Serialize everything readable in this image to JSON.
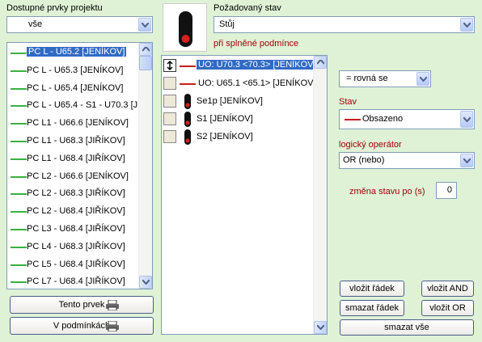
{
  "left": {
    "title": "Dostupné prvky projektu",
    "filter_value": "vše",
    "items": [
      "PC L - U65.2 [JENÍKOV]",
      "PC L - U65.3 [JENÍKOV]",
      "PC L - U65.4 [JENÍKOV]",
      "PC L - U65.4 - S1 - U70.3 [JEI",
      "PC L1 - U66.6 [JENÍKOV]",
      "PC L1 - U68.3 [JIŘÍKOV]",
      "PC L1 - U68.4 [JIŘÍKOV]",
      "PC L2 - U66.6 [JENÍKOV]",
      "PC L2 - U68.3 [JIŘÍKOV]",
      "PC L2 - U68.4 [JIŘÍKOV]",
      "PC L3 - U68.4 [JIŘÍKOV]",
      "PC L4 - U68.3 [JIŘÍKOV]",
      "PC L5 - U68.4 [JIŘÍKOV]",
      "PC L7 - U68.4 [JIŘÍKOV]"
    ],
    "btn_this": "Tento prvek",
    "btn_conditions": "V podmínkách"
  },
  "middle": {
    "state_label": "Požadovaný stav",
    "state_value": "Stůj",
    "cond_label": "při splněné podmínce",
    "conditions": [
      {
        "text": "UO: U70.3 <70.3> [JENÍKOV]",
        "icon": "red-line"
      },
      {
        "text": "UO: U65.1 <65.1> [JENÍKOV]",
        "icon": "red-line"
      },
      {
        "text": "Se1p [JENÍKOV]",
        "icon": "signal-icon"
      },
      {
        "text": "S1 [JENÍKOV]",
        "icon": "signal-icon"
      },
      {
        "text": "S2 [JENÍKOV]",
        "icon": "signal-icon"
      }
    ]
  },
  "right": {
    "compare_value": "=  rovná se",
    "stav_label": "Stav",
    "stav_value": "Obsazeno",
    "op_label": "logický operátor",
    "op_value": "OR (nebo)",
    "delay_label": "změna stavu po (s)",
    "delay_value": "0",
    "btn_insert_row": "vložit řádek",
    "btn_insert_and": "vložit AND",
    "btn_delete_row": "smazat řádek",
    "btn_insert_or": "vložit OR",
    "btn_delete_all": "smazat vše"
  },
  "colors": {
    "bg": "#dff2d6",
    "label_red": "#a0000a",
    "selection": "#316ac5",
    "track_green": "#3cb043",
    "track_red": "#c81e1e"
  }
}
